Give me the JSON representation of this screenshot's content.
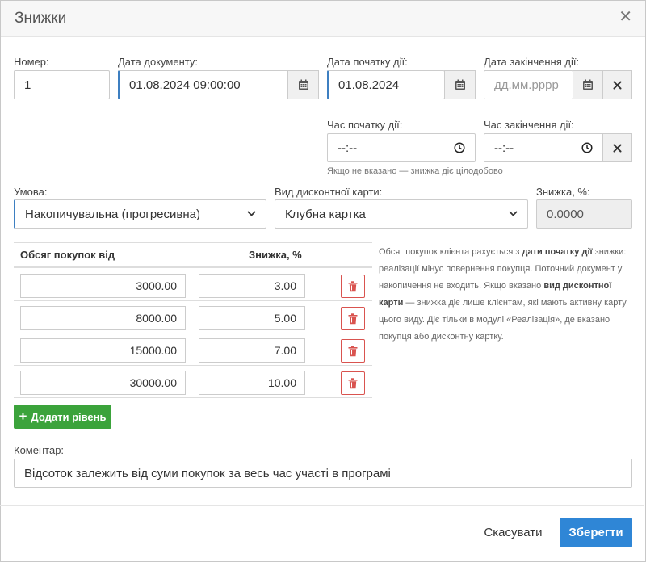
{
  "dialog": {
    "title": "Знижки"
  },
  "fields": {
    "number": {
      "label": "Номер:",
      "value": "1"
    },
    "doc_date": {
      "label": "Дата документу:",
      "value": "01.08.2024 09:00:00"
    },
    "start_date": {
      "label": "Дата початку дії:",
      "value": "01.08.2024"
    },
    "end_date": {
      "label": "Дата закінчення дії:",
      "placeholder": "дд.мм.рррр"
    },
    "start_time": {
      "label": "Час початку дії:",
      "value": "--:--"
    },
    "end_time": {
      "label": "Час закінчення дії:",
      "value": "--:--"
    },
    "time_hint": "Якщо не вказано — знижка діє цілодобово",
    "condition": {
      "label": "Умова:",
      "value": "Накопичувальна (прогресивна)"
    },
    "card_type": {
      "label": "Вид дисконтної карти:",
      "value": "Клубна картка"
    },
    "discount": {
      "label": "Знижка, %:",
      "value": "0.0000"
    },
    "comment": {
      "label": "Коментар:",
      "value": "Відсоток залежить від суми покупок за весь час участі в програмі"
    }
  },
  "levels": {
    "headers": {
      "amount": "Обсяг покупок від",
      "percent": "Знижка, %"
    },
    "rows": [
      {
        "amount": "3000.00",
        "percent": "3.00"
      },
      {
        "amount": "8000.00",
        "percent": "5.00"
      },
      {
        "amount": "15000.00",
        "percent": "7.00"
      },
      {
        "amount": "30000.00",
        "percent": "10.00"
      }
    ],
    "add_label": "Додати рівень"
  },
  "info": {
    "p1": "Обсяг покупок клієнта рахується з ",
    "b1": "дати початку дії",
    "p2": " знижки: реалізації мінус повернення покупця. Поточний документ у накопичення не входить. Якщо вказано ",
    "b2": "вид дисконтної карти",
    "p3": " — знижка діє лише клієнтам, які мають активну карту цього виду. Діє тільки в модулі «Реалізація», де вказано покупця або дисконтну картку."
  },
  "footer": {
    "cancel": "Скасувати",
    "save": "Зберегти"
  },
  "colors": {
    "primary": "#2f86d6",
    "success": "#3ba33b",
    "danger": "#d9534f",
    "focus": "#3d7fc1"
  }
}
